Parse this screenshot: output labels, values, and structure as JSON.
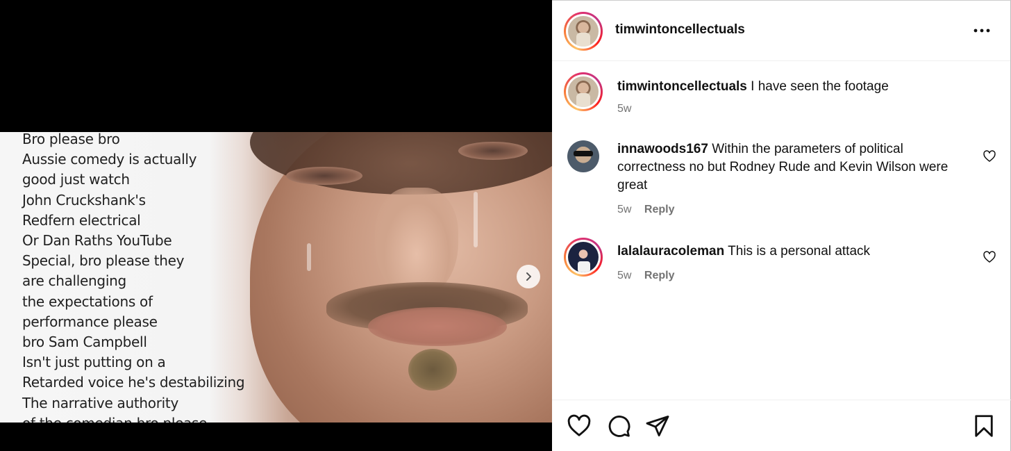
{
  "media": {
    "meme_lines": [
      "Bro please bro",
      "Aussie comedy is actually",
      "good just watch",
      "John Cruckshank's",
      "Redfern electrical",
      "Or Dan Raths YouTube",
      "Special, bro please they",
      "are challenging",
      "the expectations of",
      "performance please",
      "bro Sam Campbell",
      "Isn't just putting on a",
      "Retarded voice he's destabilizing",
      "The narrative authority",
      "of the comedian bro please"
    ],
    "next_icon": "chevron-right-icon"
  },
  "post": {
    "author": "timwintoncellectuals",
    "more_icon": "more-horizontal-icon"
  },
  "comments": [
    {
      "user": "timwintoncellectuals",
      "text": "I have seen the footage",
      "time": "5w",
      "reply_label": ""
    },
    {
      "user": "innawoods167",
      "text": "Within the parameters of political correctness no but Rodney Rude and Kevin Wilson were great",
      "time": "5w",
      "reply_label": "Reply"
    },
    {
      "user": "lalalauracoleman",
      "text": "This is a personal attack",
      "time": "5w",
      "reply_label": "Reply"
    }
  ],
  "actions": {
    "like_icon": "heart-icon",
    "comment_icon": "comment-icon",
    "share_icon": "share-icon",
    "save_icon": "bookmark-icon"
  },
  "colors": {
    "text": "#111111",
    "muted": "#737373",
    "ring_gradient": [
      "#fdc468",
      "#f77737",
      "#e1306c",
      "#c13584"
    ]
  }
}
